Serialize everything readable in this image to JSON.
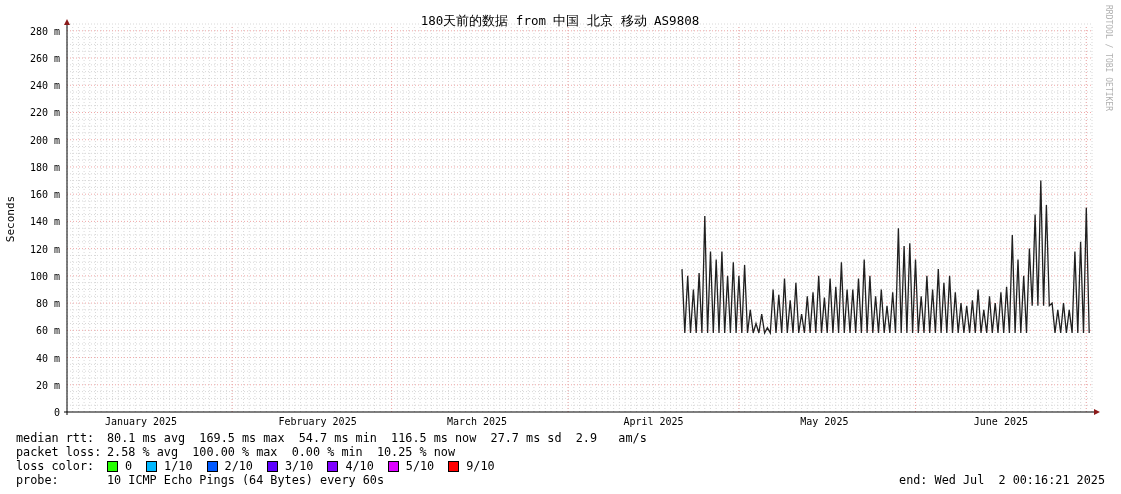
{
  "graph": {
    "side_note": "RRDTOOL / TOBI OETIKER",
    "chart_data": {
      "type": "line",
      "grid": true,
      "title": "180天前的数据 from 中国 北京 移动 AS9808",
      "ylabel": "Seconds",
      "ylim": [
        0,
        285
      ],
      "yticks": [
        {
          "value": 0,
          "label": "0"
        },
        {
          "value": 20,
          "label": "20 m"
        },
        {
          "value": 40,
          "label": "40 m"
        },
        {
          "value": 60,
          "label": "60 m"
        },
        {
          "value": 80,
          "label": "80 m"
        },
        {
          "value": 100,
          "label": "100 m"
        },
        {
          "value": 120,
          "label": "120 m"
        },
        {
          "value": 140,
          "label": "140 m"
        },
        {
          "value": 160,
          "label": "160 m"
        },
        {
          "value": 180,
          "label": "180 m"
        },
        {
          "value": 200,
          "label": "200 m"
        },
        {
          "value": 220,
          "label": "220 m"
        },
        {
          "value": 240,
          "label": "240 m"
        },
        {
          "value": 260,
          "label": "260 m"
        },
        {
          "value": 280,
          "label": "280 m"
        }
      ],
      "categories": [
        null,
        null,
        null,
        null,
        null,
        null,
        null,
        null,
        null,
        null,
        null,
        null,
        null,
        null,
        null,
        null,
        null,
        null,
        null,
        null,
        null,
        null,
        null,
        null,
        null,
        null,
        "January 2025",
        null,
        null,
        null,
        null,
        null,
        null,
        null,
        null,
        null,
        null,
        null,
        null,
        null,
        null,
        null,
        null,
        null,
        null,
        null,
        null,
        null,
        null,
        null,
        null,
        null,
        null,
        null,
        null,
        null,
        null,
        null,
        null,
        null,
        null,
        null,
        null,
        null,
        null,
        null,
        null,
        null,
        null,
        null,
        null,
        null,
        null,
        null,
        null,
        null,
        null,
        null,
        null,
        null,
        null,
        null,
        null,
        null,
        null,
        null,
        null,
        null,
        "February 2025",
        null,
        null,
        null,
        null,
        null,
        null,
        null,
        null,
        null,
        null,
        null,
        null,
        null,
        null,
        null,
        null,
        null,
        null,
        null,
        null,
        null,
        null,
        null,
        null,
        null,
        null,
        null,
        null,
        null,
        null,
        null,
        null,
        null,
        null,
        null,
        null,
        null,
        null,
        null,
        null,
        null,
        null,
        null,
        null,
        null,
        null,
        null,
        null,
        null,
        null,
        null,
        null,
        null,
        null,
        null,
        "March 2025",
        null,
        null,
        null,
        null,
        null,
        null,
        null,
        null,
        null,
        null,
        null,
        null,
        null,
        null,
        null,
        null,
        null,
        null,
        null,
        null,
        null,
        null,
        null,
        null,
        null,
        null,
        null,
        null,
        null,
        null,
        null,
        null,
        null,
        null,
        null,
        null,
        null,
        null,
        null,
        null,
        null,
        null,
        null,
        null,
        null,
        null,
        null,
        null,
        null,
        null,
        null,
        null,
        null,
        null,
        null,
        null,
        null,
        null,
        null,
        null,
        null,
        "April 2025",
        null,
        null,
        null,
        null,
        null,
        null,
        null,
        null,
        null,
        null,
        null,
        null,
        null,
        null,
        null,
        null,
        null,
        null,
        null,
        null,
        null,
        null,
        null,
        null,
        null,
        null,
        null,
        null,
        null,
        null,
        null,
        null,
        null,
        null,
        null,
        null,
        null,
        null,
        null,
        null,
        null,
        null,
        null,
        null,
        null,
        null,
        null,
        null,
        null,
        null,
        null,
        null,
        null,
        null,
        null,
        null,
        null,
        null,
        null,
        "May 2025",
        null,
        null,
        null,
        null,
        null,
        null,
        null,
        null,
        null,
        null,
        null,
        null,
        null,
        null,
        null,
        null,
        null,
        null,
        null,
        null,
        null,
        null,
        null,
        null,
        null,
        null,
        null,
        null,
        null,
        null,
        null,
        null,
        null,
        null,
        null,
        null,
        null,
        null,
        null,
        null,
        null,
        null,
        null,
        null,
        null,
        null,
        null,
        null,
        null,
        null,
        null,
        null,
        null,
        null,
        null,
        null,
        null,
        null,
        null,
        null,
        null,
        "June 2025",
        null,
        null,
        null,
        null,
        null,
        null,
        null,
        null,
        null,
        null,
        null,
        null,
        null,
        null,
        null,
        null,
        null,
        null,
        null,
        null,
        null,
        null,
        null,
        null,
        null,
        null,
        null,
        null,
        null,
        null,
        null
      ],
      "series": [
        {
          "color": "#202020",
          "values": [
            null,
            null,
            null,
            null,
            null,
            null,
            null,
            null,
            null,
            null,
            null,
            null,
            null,
            null,
            null,
            null,
            null,
            null,
            null,
            null,
            null,
            null,
            null,
            null,
            null,
            null,
            null,
            null,
            null,
            null,
            null,
            null,
            null,
            null,
            null,
            null,
            null,
            null,
            null,
            null,
            null,
            null,
            null,
            null,
            null,
            null,
            null,
            null,
            null,
            null,
            null,
            null,
            null,
            null,
            null,
            null,
            null,
            null,
            null,
            null,
            null,
            null,
            null,
            null,
            null,
            null,
            null,
            null,
            null,
            null,
            null,
            null,
            null,
            null,
            null,
            null,
            null,
            null,
            null,
            null,
            null,
            null,
            null,
            null,
            null,
            null,
            null,
            null,
            null,
            null,
            null,
            null,
            null,
            null,
            null,
            null,
            null,
            null,
            null,
            null,
            null,
            null,
            null,
            null,
            null,
            null,
            null,
            null,
            null,
            null,
            null,
            null,
            null,
            null,
            null,
            null,
            null,
            null,
            null,
            null,
            null,
            null,
            null,
            null,
            null,
            null,
            null,
            null,
            null,
            null,
            null,
            null,
            null,
            null,
            null,
            null,
            null,
            null,
            null,
            null,
            null,
            null,
            null,
            null,
            null,
            null,
            null,
            null,
            null,
            null,
            null,
            null,
            null,
            null,
            null,
            null,
            null,
            null,
            null,
            null,
            null,
            null,
            null,
            null,
            null,
            null,
            null,
            null,
            null,
            null,
            null,
            null,
            null,
            null,
            null,
            null,
            null,
            null,
            null,
            null,
            null,
            null,
            null,
            null,
            null,
            null,
            null,
            null,
            null,
            null,
            null,
            null,
            null,
            null,
            null,
            null,
            null,
            null,
            null,
            null,
            null,
            null,
            null,
            null,
            null,
            null,
            null,
            null,
            null,
            null,
            null,
            null,
            null,
            null,
            null,
            null,
            105,
            58,
            100,
            58,
            90,
            58,
            102,
            58,
            144,
            58,
            118,
            58,
            112,
            58,
            118,
            58,
            100,
            58,
            110,
            58,
            100,
            58,
            108,
            58,
            75,
            58,
            65,
            58,
            72,
            58,
            62,
            58,
            90,
            58,
            86,
            58,
            98,
            58,
            82,
            58,
            95,
            58,
            72,
            58,
            85,
            58,
            88,
            58,
            100,
            58,
            84,
            58,
            98,
            58,
            92,
            58,
            110,
            58,
            90,
            58,
            90,
            58,
            98,
            58,
            112,
            58,
            100,
            58,
            85,
            58,
            90,
            58,
            78,
            58,
            88,
            58,
            135,
            58,
            122,
            58,
            124,
            58,
            112,
            58,
            85,
            58,
            100,
            58,
            90,
            58,
            105,
            58,
            95,
            58,
            100,
            58,
            88,
            58,
            80,
            58,
            78,
            58,
            82,
            58,
            90,
            58,
            75,
            58,
            85,
            58,
            80,
            58,
            88,
            58,
            92,
            58,
            130,
            58,
            112,
            58,
            100,
            58,
            120,
            78,
            145,
            78,
            170,
            78,
            152,
            78,
            80,
            58,
            75,
            58,
            80,
            58,
            75,
            58,
            118,
            58,
            125,
            58,
            150,
            58
          ]
        }
      ]
    }
  },
  "legend": [
    {
      "kind": "text",
      "label": "median rtt:",
      "value": "80.1 ms avg  169.5 ms max  54.7 ms min  116.5 ms now  27.7 ms sd  2.9   am/s"
    },
    {
      "kind": "text",
      "label": "packet loss:",
      "value": "2.58 % avg  100.00 % max  0.00 % min  10.25 % now"
    },
    {
      "kind": "swatches",
      "label": "loss color:",
      "items": [
        {
          "label": "0",
          "color": "#26ff00"
        },
        {
          "label": "1/10",
          "color": "#00b8ff"
        },
        {
          "label": "2/10",
          "color": "#0059ff"
        },
        {
          "label": "3/10",
          "color": "#5e00ff"
        },
        {
          "label": "4/10",
          "color": "#7e00ff"
        },
        {
          "label": "5/10",
          "color": "#dd00ff"
        },
        {
          "label": "9/10",
          "color": "#ff0000"
        }
      ]
    },
    {
      "kind": "text",
      "label": "probe:",
      "value": "10 ICMP Echo Pings (64 Bytes) every 60s",
      "end": "end: Wed Jul  2 00:16:21 2025"
    }
  ]
}
